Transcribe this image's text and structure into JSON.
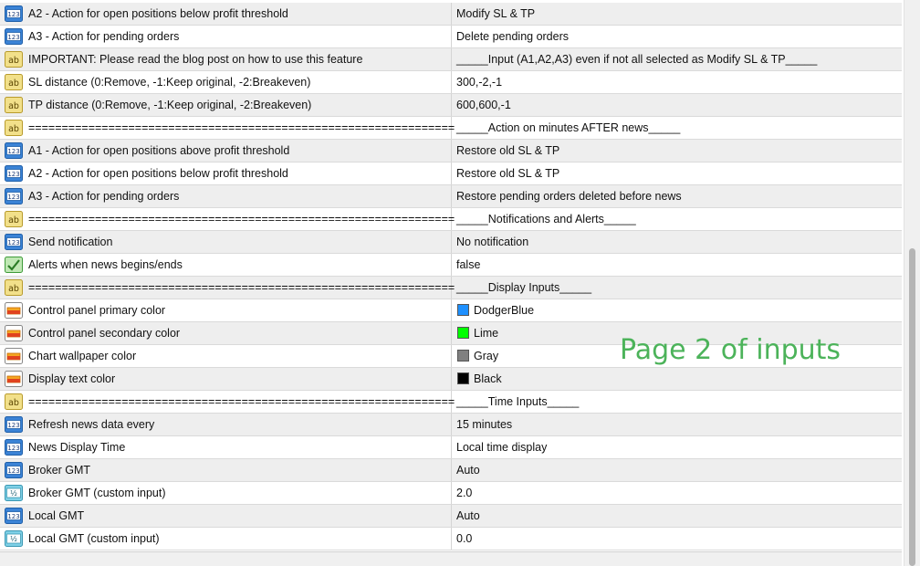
{
  "overlay_text": "Page 2 of inputs",
  "rows": [
    {
      "icon": "int-123-icon",
      "name": "A2 - Action for open positions below profit threshold",
      "value": "Modify SL & TP"
    },
    {
      "icon": "int-123-icon",
      "name": "A3 - Action for pending orders",
      "value": "Delete pending orders"
    },
    {
      "icon": "string-ab-icon",
      "name": "IMPORTANT: Please read the blog post on how to use this feature",
      "value": "_____Input (A1,A2,A3) even if not all selected as Modify SL & TP_____"
    },
    {
      "icon": "string-ab-icon",
      "name": "SL distance (0:Remove, -1:Keep original, -2:Breakeven)",
      "value": "300,-2,-1"
    },
    {
      "icon": "string-ab-icon",
      "name": "TP distance (0:Remove, -1:Keep original, -2:Breakeven)",
      "value": "600,600,-1"
    },
    {
      "icon": "string-ab-icon",
      "name": "================================================================",
      "value": "_____Action on minutes AFTER news_____"
    },
    {
      "icon": "int-123-icon",
      "name": "A1 - Action for open positions above profit threshold",
      "value": "Restore old SL & TP"
    },
    {
      "icon": "int-123-icon",
      "name": "A2 - Action for open positions below profit threshold",
      "value": "Restore old SL & TP"
    },
    {
      "icon": "int-123-icon",
      "name": "A3 - Action for pending orders",
      "value": "Restore pending orders deleted before news"
    },
    {
      "icon": "string-ab-icon",
      "name": "================================================================",
      "value": "_____Notifications and Alerts_____"
    },
    {
      "icon": "int-123-icon",
      "name": "Send notification",
      "value": "No notification"
    },
    {
      "icon": "bool-check-icon",
      "name": "Alerts when news begins/ends",
      "value": "false"
    },
    {
      "icon": "string-ab-icon",
      "name": "================================================================",
      "value": "_____Display Inputs_____"
    },
    {
      "icon": "color-palette-icon",
      "name": "Control panel primary color",
      "value": "DodgerBlue",
      "swatch": "#1E90FF"
    },
    {
      "icon": "color-palette-icon",
      "name": "Control panel secondary color",
      "value": "Lime",
      "swatch": "#00FF00"
    },
    {
      "icon": "color-palette-icon",
      "name": "Chart wallpaper color",
      "value": "Gray",
      "swatch": "#808080"
    },
    {
      "icon": "color-palette-icon",
      "name": "Display text color",
      "value": "Black",
      "swatch": "#000000"
    },
    {
      "icon": "string-ab-icon",
      "name": "================================================================",
      "value": "_____Time Inputs_____"
    },
    {
      "icon": "int-123-icon",
      "name": "Refresh news data every",
      "value": "15 minutes"
    },
    {
      "icon": "int-123-icon",
      "name": "News Display Time",
      "value": "Local time display"
    },
    {
      "icon": "int-123-icon",
      "name": "Broker GMT",
      "value": "Auto"
    },
    {
      "icon": "double-half-icon",
      "name": "Broker GMT (custom input)",
      "value": "2.0"
    },
    {
      "icon": "int-123-icon",
      "name": "Local GMT",
      "value": "Auto"
    },
    {
      "icon": "double-half-icon",
      "name": "Local GMT (custom input)",
      "value": "0.0"
    }
  ]
}
